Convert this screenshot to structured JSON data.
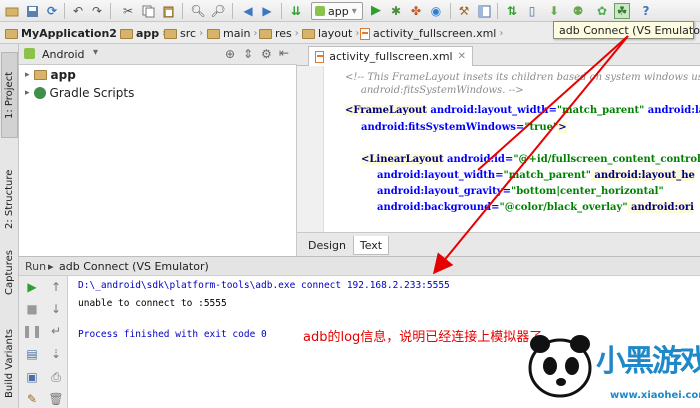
{
  "toolbar": {
    "run_config": "app",
    "tooltip": "adb Connect (VS Emulator)"
  },
  "breadcrumbs": [
    "MyApplication2",
    "app",
    "src",
    "main",
    "res",
    "layout",
    "activity_fullscreen.xml"
  ],
  "side_tabs": {
    "project": "1: Project",
    "structure": "2: Structure",
    "captures": "Captures",
    "build_variants": "Build Variants"
  },
  "project_panel": {
    "view_mode": "Android",
    "items": [
      "app",
      "Gradle Scripts"
    ]
  },
  "editor": {
    "file_tab": "activity_fullscreen.xml",
    "bottom_tabs": [
      "Design",
      "Text"
    ],
    "active_bottom_tab": "Text",
    "lines": [
      {
        "kind": "comment",
        "text": "<!-- This FrameLayout insets its children based on system windows usi"
      },
      {
        "kind": "comment",
        "text": "     android:fitsSystemWindows. -->"
      },
      {
        "kind": "tag",
        "tag": "<FrameLayout",
        "attr": " android:layout_width=",
        "val": "\"match_parent\"",
        "attr2": " android:lay"
      },
      {
        "kind": "attr",
        "attr": "android:fitsSystemWindows=",
        "val": "\"true\"",
        "tail": ">"
      },
      {
        "kind": "blank"
      },
      {
        "kind": "tag",
        "tag": "<LinearLayout",
        "attr": " android:id=",
        "val": "\"@+id/fullscreen_content_control",
        "attr2": ""
      },
      {
        "kind": "attr",
        "attr": "android:layout_width=",
        "val": "\"match_parent\"",
        "tail": " android:layout_he"
      },
      {
        "kind": "attr",
        "attr": "android:layout_gravity=",
        "val": "\"bottom|center_horizontal\"",
        "tail": ""
      },
      {
        "kind": "attr",
        "attr": "android:background=",
        "val": "\"@color/black_overlay\"",
        "tail": " android:ori"
      }
    ]
  },
  "run_panel": {
    "label": "Run",
    "config": "adb Connect (VS Emulator)",
    "console": [
      "D:\\_android\\sdk\\platform-tools\\adb.exe connect 192.168.2.233:5555",
      "unable to connect to :5555",
      "",
      "Process finished with exit code 0"
    ],
    "annotation": "adb的log信息，说明已经连接上模拟器了。"
  },
  "watermark": {
    "brand": "小黑游戏",
    "url": "www.xiaohei.com"
  },
  "colors": {
    "annotation": "#e60000",
    "arrow": "#e60000",
    "run_green": "#2f9e2f"
  }
}
